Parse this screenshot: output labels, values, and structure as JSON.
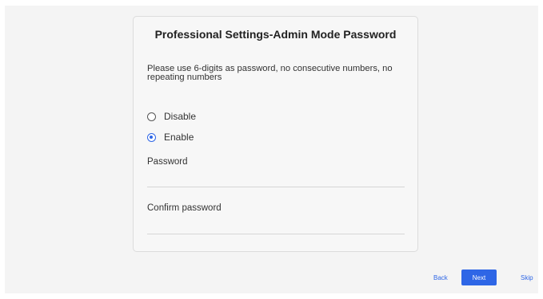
{
  "card": {
    "title": "Professional Settings-Admin Mode Password",
    "description": "Please use 6-digits as password, no consecutive numbers, no repeating numbers",
    "options": [
      {
        "label": "Disable",
        "selected": false
      },
      {
        "label": "Enable",
        "selected": true
      }
    ],
    "password_label": "Password",
    "password_value": "",
    "confirm_label": "Confirm password",
    "confirm_value": ""
  },
  "footer": {
    "back_label": "Back",
    "next_label": "Next",
    "skip_label": "Skip"
  },
  "colors": {
    "accent": "#2e66e6",
    "background": "#f4f4f4",
    "card_border": "#dcdcdc"
  }
}
